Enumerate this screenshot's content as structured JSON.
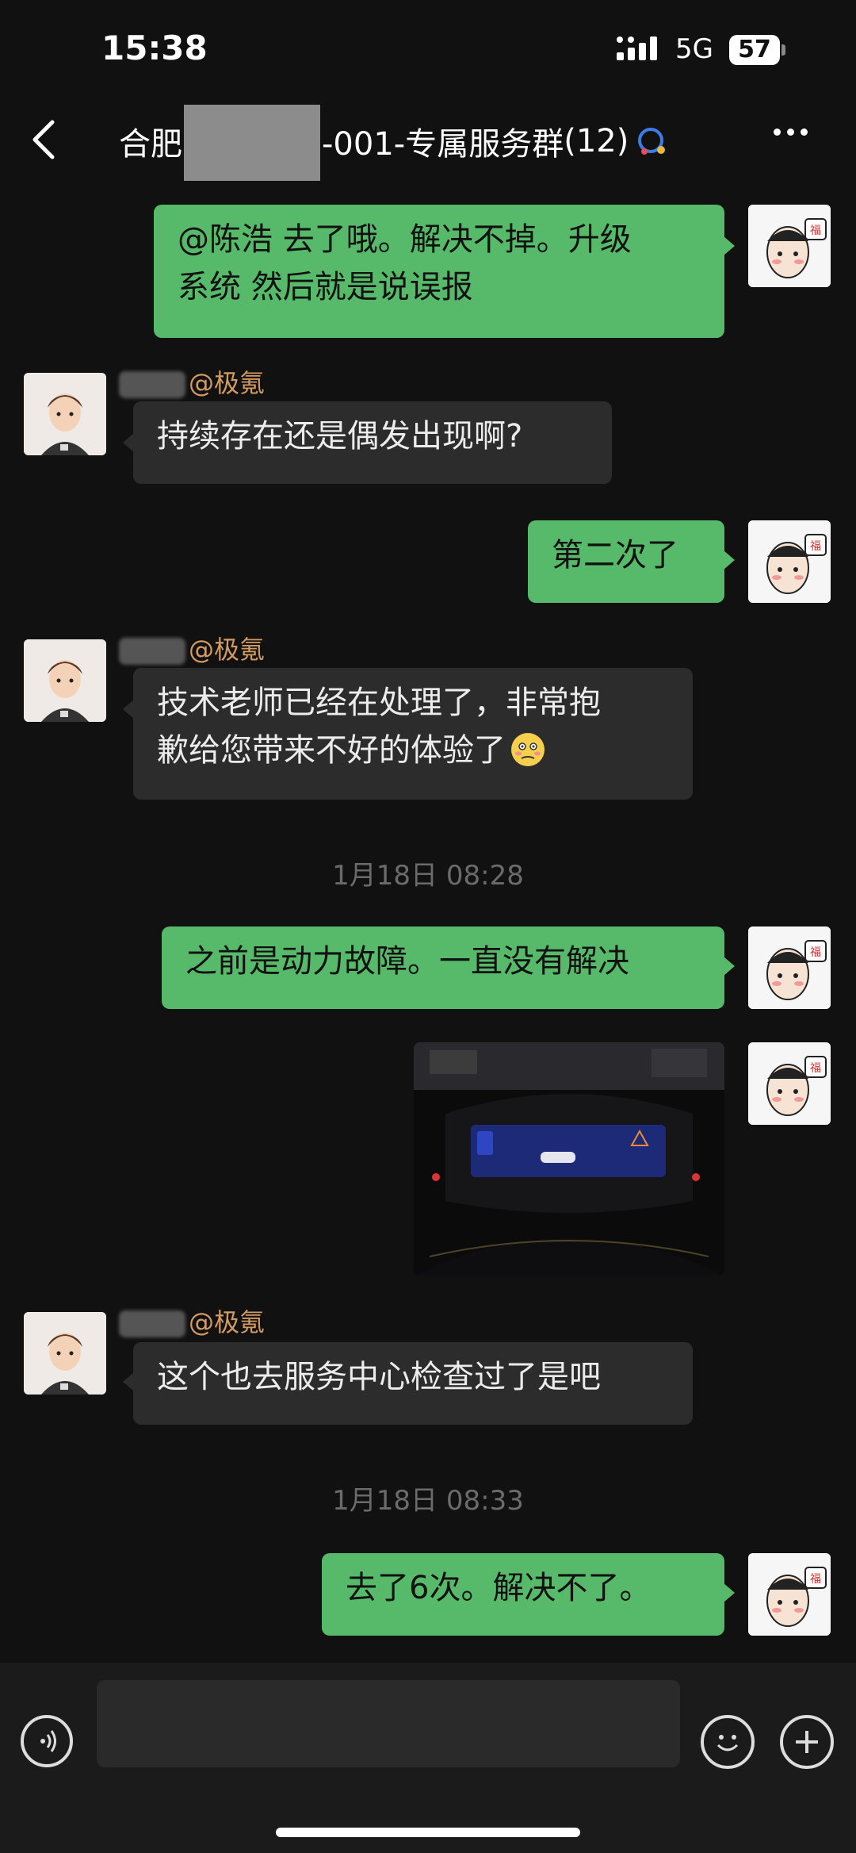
{
  "status_bar": {
    "time": "15:38",
    "network": "5G",
    "battery": "57"
  },
  "header": {
    "title_prefix": "合肥",
    "title_suffix": "-001-专属服务群",
    "member_count": "(12)"
  },
  "messages": [
    {
      "from": "me",
      "text_line1": "@陈浩 去了哦。解决不掉。升级",
      "text_line2": "系统 然后就是说误报"
    },
    {
      "from": "agent",
      "sender_tag": "@极氪",
      "text": "持续存在还是偶发出现啊?"
    },
    {
      "from": "me",
      "text": "第二次了"
    },
    {
      "from": "agent",
      "sender_tag": "@极氪",
      "text_line1": "技术老师已经在处理了，非常抱",
      "text_line2": "歉给您带来不好的体验了"
    },
    {
      "timestamp": "1月18日 08:28"
    },
    {
      "from": "me",
      "text": "之前是动力故障。一直没有解决"
    },
    {
      "from": "me",
      "type": "image",
      "description_icon": "dashboard-photo"
    },
    {
      "from": "agent",
      "sender_tag": "@极氪",
      "text": "这个也去服务中心检查过了是吧"
    },
    {
      "timestamp": "1月18日 08:33"
    },
    {
      "from": "me",
      "text": "去了6次。解决不了。"
    }
  ],
  "colors": {
    "my_bubble": "#57ba6a",
    "other_bubble": "#2c2c2c",
    "background": "#111111",
    "sender_tag": "#d39a62"
  }
}
